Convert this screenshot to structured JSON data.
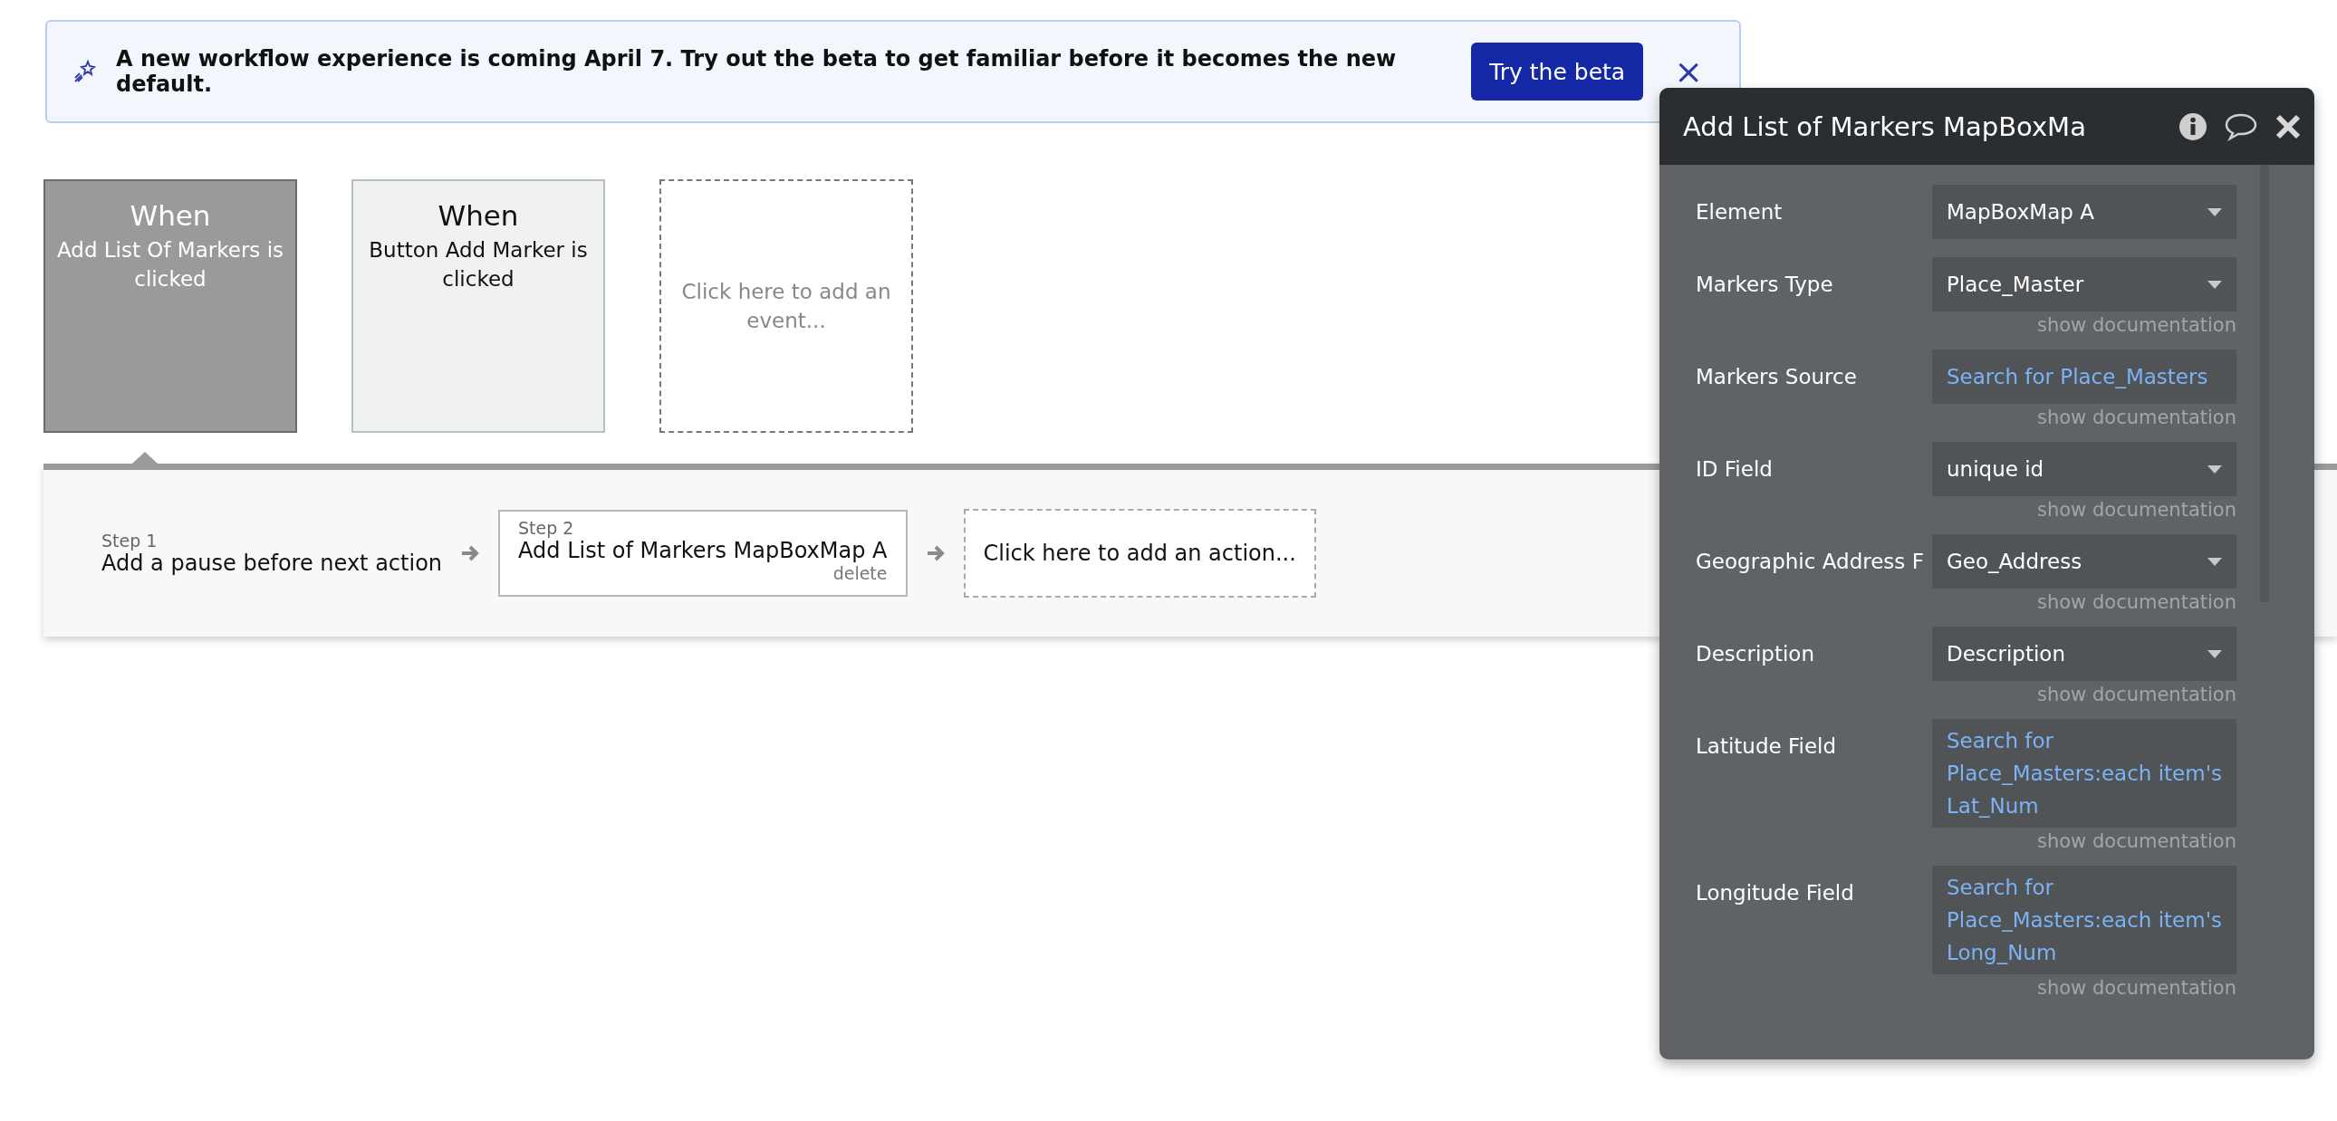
{
  "banner": {
    "message": "A new workflow experience is coming April 7. Try out the beta to get familiar before it becomes the new default.",
    "button": "Try the beta",
    "close": "×"
  },
  "events": [
    {
      "kind": "event",
      "title": "When",
      "subtitle": "Add List Of Markers is clicked",
      "selected": true
    },
    {
      "kind": "event",
      "title": "When",
      "subtitle": "Button Add Marker is clicked",
      "selected": false
    },
    {
      "kind": "placeholder",
      "subtitle": "Click here to add an event..."
    }
  ],
  "steps": [
    {
      "kind": "step",
      "label": "Step 1",
      "text": "Add a pause before next action",
      "selected": false
    },
    {
      "kind": "step",
      "label": "Step 2",
      "text": "Add List of Markers MapBoxMap A",
      "delete": "delete",
      "selected": true
    },
    {
      "kind": "placeholder",
      "text": "Click here to add an action..."
    }
  ],
  "panel": {
    "title": "Add List of Markers MapBoxMa",
    "rows": [
      {
        "label": "Element",
        "kind": "dropdown",
        "value": "MapBoxMap A"
      },
      {
        "label": "Markers Type",
        "kind": "dropdown",
        "value": "Place_Master",
        "doc": "show documentation"
      },
      {
        "label": "Markers Source",
        "kind": "expression",
        "value": "Search for Place_Masters",
        "doc": "show documentation"
      },
      {
        "label": "ID Field",
        "kind": "dropdown",
        "value": "unique id",
        "doc": "show documentation"
      },
      {
        "label": "Geographic Address F",
        "kind": "dropdown",
        "value": "Geo_Address",
        "doc": "show documentation"
      },
      {
        "label": "Description",
        "kind": "dropdown",
        "value": "Description",
        "doc": "show documentation"
      },
      {
        "label": "Latitude Field",
        "kind": "expression",
        "value": "Search for Place_Masters:each item's Lat_Num",
        "doc": "show documentation"
      },
      {
        "label": "Longitude Field",
        "kind": "expression",
        "value": "Search for Place_Masters:each item's Long_Num",
        "doc": "show documentation"
      }
    ]
  }
}
